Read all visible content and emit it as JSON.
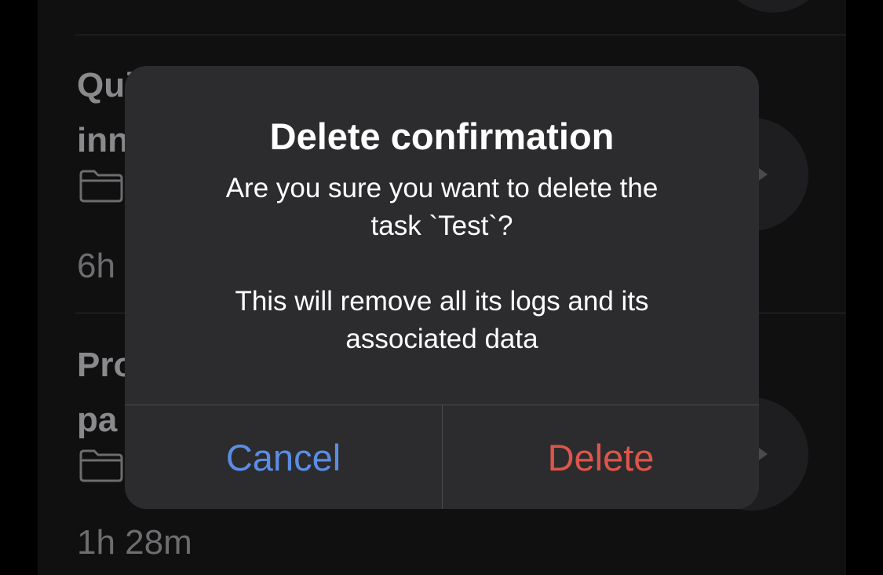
{
  "background_tasks": [
    {
      "title_lines": [
        "Qui",
        "inn"
      ],
      "duration": "6h",
      "folder_icon": "folder-icon",
      "play_icon": "play-icon"
    },
    {
      "title_lines": [
        "Pro",
        "pa"
      ],
      "duration": "1h 28m",
      "folder_icon": "folder-icon",
      "play_icon": "play-icon"
    }
  ],
  "dialog": {
    "title": "Delete confirmation",
    "message_lines": [
      "Are you sure you want to delete the",
      "task `Test`?",
      "This will remove all its logs and its",
      "associated data"
    ],
    "cancel_label": "Cancel",
    "delete_label": "Delete"
  },
  "colors": {
    "cancel": "#5b8de6",
    "delete": "#de554b",
    "dialog_bg": "#2c2c2e"
  }
}
